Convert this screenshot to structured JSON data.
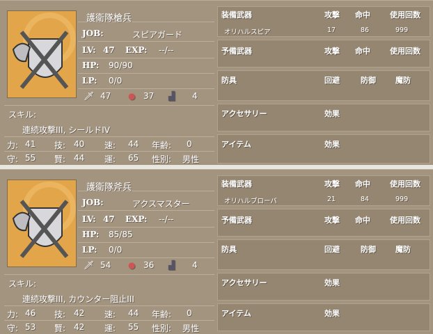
{
  "units": [
    {
      "name": "護衛隊槍兵",
      "job_label": "JOB:",
      "job": "スピアガード",
      "lv_label": "LV:",
      "lv": "47",
      "exp_label": "EXP:",
      "exp": "--/--",
      "hp_label": "HP:",
      "hp": "90/90",
      "lp_label": "LP:",
      "lp": "0/0",
      "atk_icon_value": "47",
      "def_icon_value": "37",
      "move_icon_value": "4",
      "skill_label": "スキル:",
      "skills": "連続攻撃III, シールドIV",
      "attrs": [
        {
          "label": "力:",
          "value": "41"
        },
        {
          "label": "技:",
          "value": "40"
        },
        {
          "label": "速:",
          "value": "44"
        },
        {
          "label": "年齢:",
          "value": "0"
        },
        {
          "label": "守:",
          "value": "55"
        },
        {
          "label": "賢:",
          "value": "44"
        },
        {
          "label": "運:",
          "value": "65"
        },
        {
          "label": "性別:",
          "value": "男性"
        }
      ],
      "weapon": {
        "header": "装備武器",
        "col1": "攻撃",
        "col2": "命中",
        "col3": "使用回数",
        "item": "オリハルスピア",
        "v1": "17",
        "v2": "86",
        "v3": "999"
      },
      "sub_weapon": {
        "header": "予備武器",
        "col1": "攻撃",
        "col2": "命中",
        "col3": "使用回数"
      },
      "armor": {
        "header": "防具",
        "col1": "回避",
        "col2": "防御",
        "col3": "魔防"
      },
      "accessory": {
        "header": "アクセサリー",
        "col1": "効果"
      },
      "item": {
        "header": "アイテム",
        "col1": "効果"
      }
    },
    {
      "name": "護衛隊斧兵",
      "job_label": "JOB:",
      "job": "アクスマスター",
      "lv_label": "LV:",
      "lv": "47",
      "exp_label": "EXP:",
      "exp": "--/--",
      "hp_label": "HP:",
      "hp": "85/85",
      "lp_label": "LP:",
      "lp": "0/0",
      "atk_icon_value": "54",
      "def_icon_value": "36",
      "move_icon_value": "4",
      "skill_label": "スキル:",
      "skills": "連続攻撃III, カウンター阻止III",
      "attrs": [
        {
          "label": "力:",
          "value": "46"
        },
        {
          "label": "技:",
          "value": "42"
        },
        {
          "label": "速:",
          "value": "44"
        },
        {
          "label": "年齢:",
          "value": "0"
        },
        {
          "label": "守:",
          "value": "53"
        },
        {
          "label": "賢:",
          "value": "42"
        },
        {
          "label": "運:",
          "value": "55"
        },
        {
          "label": "性別:",
          "value": "男性"
        }
      ],
      "weapon": {
        "header": "装備武器",
        "col1": "攻撃",
        "col2": "命中",
        "col3": "使用回数",
        "item": "オリハルブローバ",
        "v1": "21",
        "v2": "84",
        "v3": "999"
      },
      "sub_weapon": {
        "header": "予備武器",
        "col1": "攻撃",
        "col2": "命中",
        "col3": "使用回数"
      },
      "armor": {
        "header": "防具",
        "col1": "回避",
        "col2": "防御",
        "col3": "魔防"
      },
      "accessory": {
        "header": "アクセサリー",
        "col1": "効果"
      },
      "item": {
        "header": "アイテム",
        "col1": "効果"
      }
    }
  ]
}
